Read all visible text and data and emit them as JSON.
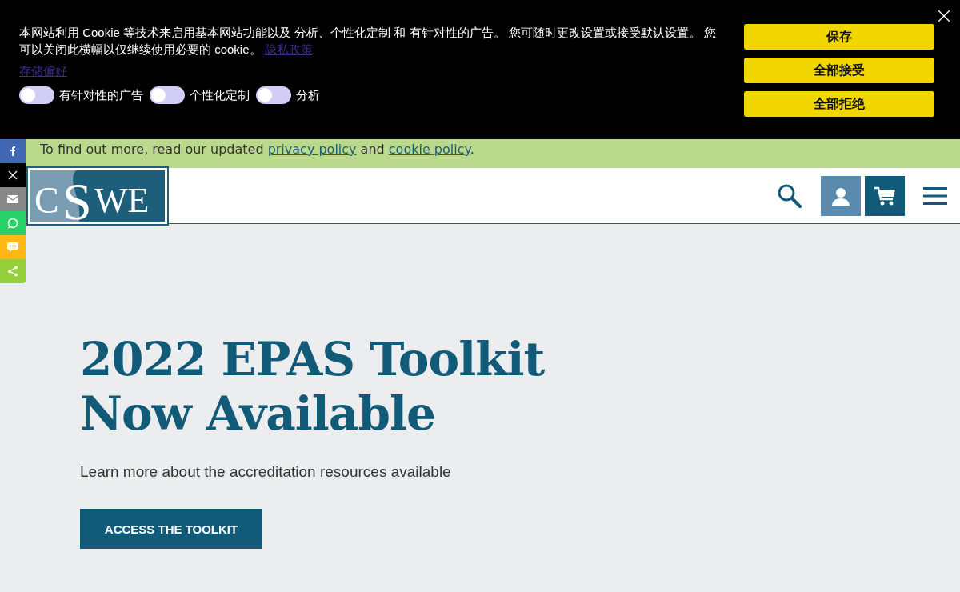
{
  "cookie_banner": {
    "message": "本网站利用 Cookie 等技术来启用基本网站功能以及 分析、个性化定制 和 有针对性的广告。 您可随时更改设置或接受默认设置。 您可以关闭此横幅以仅继续使用必要的 cookie。",
    "privacy_link": "隐私政策",
    "preferences_link": "存储偏好",
    "toggles": [
      {
        "label": "有针对性的广告",
        "on": false
      },
      {
        "label": "个性化定制",
        "on": false
      },
      {
        "label": "分析",
        "on": false
      }
    ],
    "buttons": [
      "保存",
      "全部接受",
      "全部拒绝"
    ]
  },
  "notice": {
    "before": "To find out more, read our updated",
    "link_1": "privacy policy",
    "middle": "and",
    "link_2": "cookie policy",
    "after": "."
  },
  "logo": {
    "letters": [
      "C",
      "S",
      "WE"
    ]
  },
  "hero": {
    "title_lines": [
      "2022 EPAS Toolkit",
      "Now Available"
    ],
    "subtitle": "Learn more about the accreditation resources available",
    "button": "ACCESS THE TOOLKIT"
  }
}
